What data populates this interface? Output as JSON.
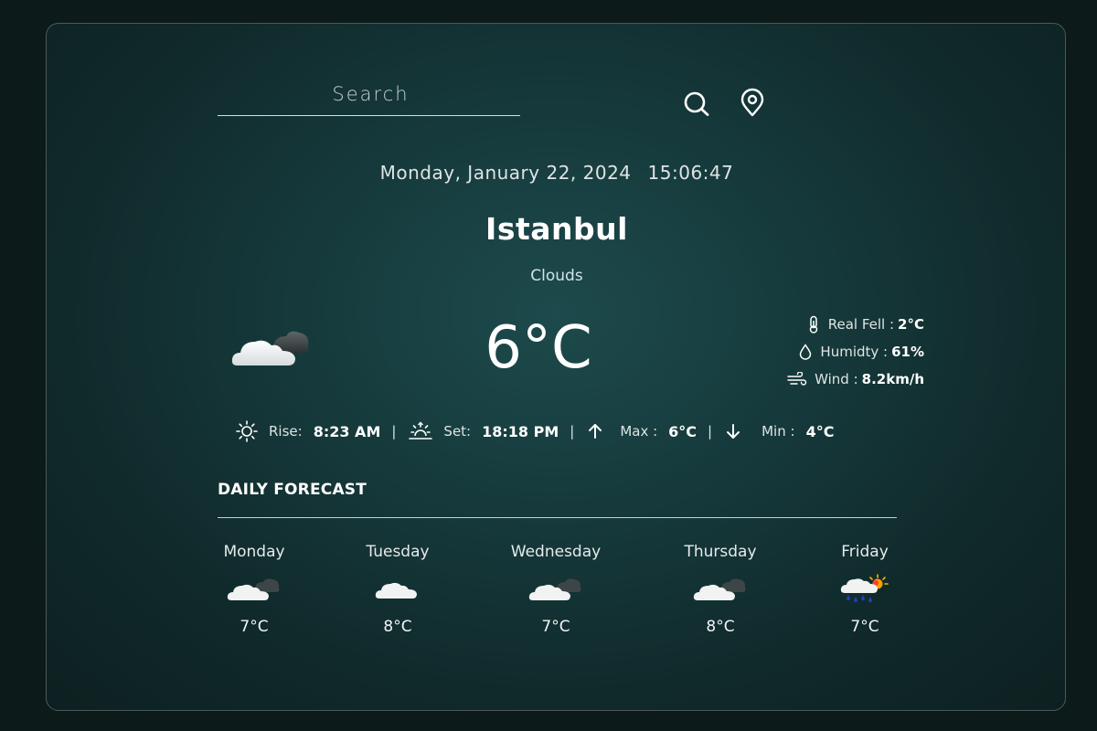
{
  "search": {
    "placeholder": "Search"
  },
  "header": {
    "date": "Monday, January 22, 2024",
    "time": "15:06:47"
  },
  "current": {
    "city": "Istanbul",
    "condition": "Clouds",
    "temperature": "6°C",
    "icon": "cloud-icon",
    "details": [
      {
        "icon": "thermometer-icon",
        "label": "Real Fell :",
        "value": "2°C"
      },
      {
        "icon": "droplet-icon",
        "label": "Humidty :",
        "value": "61%"
      },
      {
        "icon": "wind-icon",
        "label": "Wind :",
        "value": "8.2km/h"
      }
    ]
  },
  "sun": {
    "rise_label": "Rise:",
    "rise_value": "8:23 AM",
    "set_label": "Set:",
    "set_value": "18:18 PM",
    "max_label": "Max :",
    "max_value": "6°C",
    "min_label": "Min :",
    "min_value": "4°C",
    "separator": "|"
  },
  "forecast": {
    "title": "DAILY FORECAST",
    "days": [
      {
        "name": "Monday",
        "temp": "7°C",
        "icon": "broken-clouds-icon"
      },
      {
        "name": "Tuesday",
        "temp": "8°C",
        "icon": "cloud-icon"
      },
      {
        "name": "Wednesday",
        "temp": "7°C",
        "icon": "broken-clouds-icon"
      },
      {
        "name": "Thursday",
        "temp": "8°C",
        "icon": "broken-clouds-icon"
      },
      {
        "name": "Friday",
        "temp": "7°C",
        "icon": "rain-sun-icon"
      }
    ]
  },
  "colors": {
    "background": "#0c1a1a",
    "card": "#1d4a4c",
    "text": "#ffffff"
  }
}
